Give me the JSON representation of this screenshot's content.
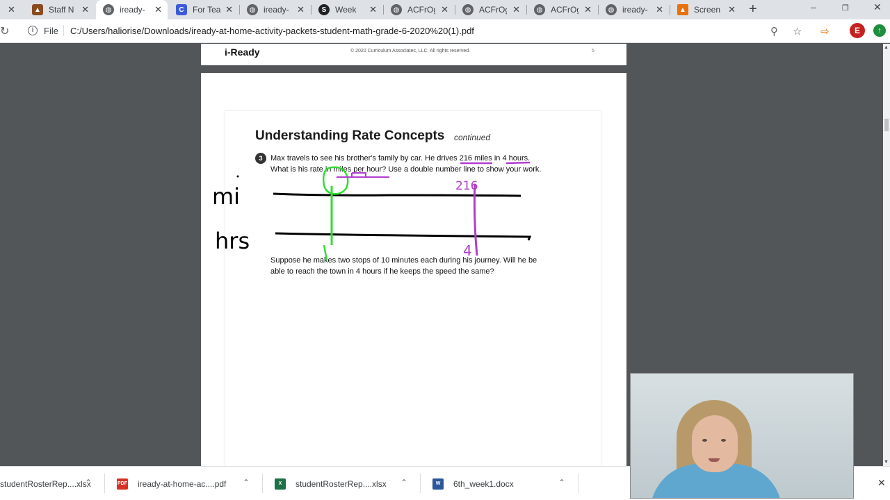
{
  "browser": {
    "tabs": [
      {
        "label": "Staff N",
        "icon": "app-icon",
        "color": "#8a4b1f",
        "active": false
      },
      {
        "label": "iready-",
        "icon": "globe-icon",
        "color": "#5f6368",
        "active": true
      },
      {
        "label": "For Tea",
        "icon": "c-logo-icon",
        "color": "#3b5bdb",
        "active": false
      },
      {
        "label": "iready-",
        "icon": "globe-icon",
        "color": "#5f6368",
        "active": false
      },
      {
        "label": "Week",
        "icon": "s-logo-icon",
        "color": "#202124",
        "active": false
      },
      {
        "label": "ACFrOg",
        "icon": "globe-icon",
        "color": "#5f6368",
        "active": false
      },
      {
        "label": "ACFrOg",
        "icon": "globe-icon",
        "color": "#5f6368",
        "active": false
      },
      {
        "label": "ACFrOg",
        "icon": "globe-icon",
        "color": "#5f6368",
        "active": false
      },
      {
        "label": "iready-",
        "icon": "globe-icon",
        "color": "#5f6368",
        "active": false
      },
      {
        "label": "Screen",
        "icon": "screencast-icon",
        "color": "#e8710a",
        "active": false
      }
    ],
    "address": {
      "scheme_label": "File",
      "url": "C:/Users/haliorise/Downloads/iready-at-home-activity-packets-student-math-grade-6-2020%20(1).pdf"
    },
    "profile_initial": "E"
  },
  "pdf": {
    "page1": {
      "brand": "i-Ready",
      "copyright": "© 2020 Curriculum Associates, LLC. All rights reserved.",
      "page_number": "5"
    },
    "page2": {
      "heading": "Understanding Rate Concepts",
      "heading_suffix": "continued",
      "question_number": "3",
      "question_line1": "Max travels to see his brother's family by car. He drives 216 miles in 4 hours.",
      "question_line2": "What is his rate in miles per hour? Use a double number line to show your work.",
      "part_line1": "Suppose he makes two stops of 10 minutes each during his journey. Will he be",
      "part_line2": "able to reach the town in 4 hours if he keeps the speed the same?"
    },
    "annotations": {
      "miles_label": "mi",
      "hours_label": "hrs",
      "miles_value": "216",
      "hours_value": "4",
      "colors": {
        "black": "#000000",
        "green": "#33dd33",
        "purple": "#b23ccf"
      }
    }
  },
  "downloads": [
    {
      "name": "studentRosterRep....xlsx",
      "icon": "excel-icon",
      "color": "#1e7145"
    },
    {
      "name": "iready-at-home-ac....pdf",
      "icon": "pdf-icon",
      "color": "#d93025"
    },
    {
      "name": "studentRosterRep....xlsx",
      "icon": "excel-icon",
      "color": "#1e7145"
    },
    {
      "name": "6th_week1.docx",
      "icon": "word-icon",
      "color": "#2b579a"
    }
  ]
}
